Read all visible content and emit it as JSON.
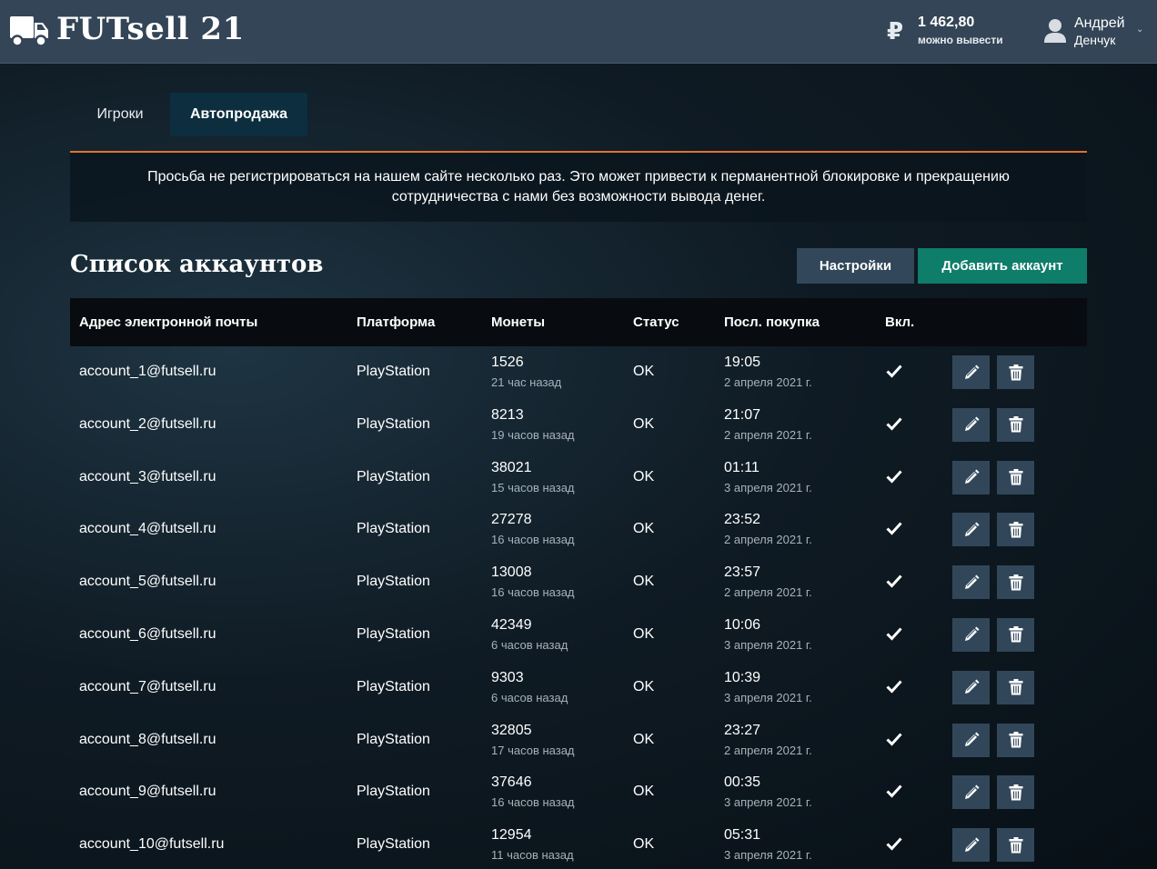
{
  "header": {
    "brand": "FUTsell 21",
    "logo_icon": "delivery-truck-icon",
    "balance": {
      "icon": "ruble-icon",
      "symbol": "₽",
      "amount": "1 462,80",
      "caption": "можно вывести"
    },
    "user": {
      "icon": "user-icon",
      "first_name": "Андрей",
      "last_name": "Денчук",
      "caret": "⌄"
    }
  },
  "tabs": [
    {
      "label": "Игроки",
      "active": false
    },
    {
      "label": "Автопродажа",
      "active": true
    }
  ],
  "notice": "Просьба не регистрироваться на нашем сайте несколько раз. Это может привести к перманентной блокировке и прекращению сотрудничества с нами без возможности вывода денег.",
  "accounts_section": {
    "title": "Список аккаунтов",
    "settings_button": "Настройки",
    "add_button": "Добавить аккаунт"
  },
  "table": {
    "columns": [
      "Адрес электронной почты",
      "Платформа",
      "Монеты",
      "Статус",
      "Посл. покупка",
      "Вкл."
    ],
    "rows": [
      {
        "email": "account_1@futsell.ru",
        "platform": "PlayStation",
        "coins": "1526",
        "coins_ago": "21 час назад",
        "status": "OK",
        "time": "19:05",
        "date": "2 апреля 2021 г.",
        "enabled": true
      },
      {
        "email": "account_2@futsell.ru",
        "platform": "PlayStation",
        "coins": "8213",
        "coins_ago": "19 часов назад",
        "status": "OK",
        "time": "21:07",
        "date": "2 апреля 2021 г.",
        "enabled": true
      },
      {
        "email": "account_3@futsell.ru",
        "platform": "PlayStation",
        "coins": "38021",
        "coins_ago": "15 часов назад",
        "status": "OK",
        "time": "01:11",
        "date": "3 апреля 2021 г.",
        "enabled": true
      },
      {
        "email": "account_4@futsell.ru",
        "platform": "PlayStation",
        "coins": "27278",
        "coins_ago": "16 часов назад",
        "status": "OK",
        "time": "23:52",
        "date": "2 апреля 2021 г.",
        "enabled": true
      },
      {
        "email": "account_5@futsell.ru",
        "platform": "PlayStation",
        "coins": "13008",
        "coins_ago": "16 часов назад",
        "status": "OK",
        "time": "23:57",
        "date": "2 апреля 2021 г.",
        "enabled": true
      },
      {
        "email": "account_6@futsell.ru",
        "platform": "PlayStation",
        "coins": "42349",
        "coins_ago": "6 часов назад",
        "status": "OK",
        "time": "10:06",
        "date": "3 апреля 2021 г.",
        "enabled": true
      },
      {
        "email": "account_7@futsell.ru",
        "platform": "PlayStation",
        "coins": "9303",
        "coins_ago": "6 часов назад",
        "status": "OK",
        "time": "10:39",
        "date": "3 апреля 2021 г.",
        "enabled": true
      },
      {
        "email": "account_8@futsell.ru",
        "platform": "PlayStation",
        "coins": "32805",
        "coins_ago": "17 часов назад",
        "status": "OK",
        "time": "23:27",
        "date": "2 апреля 2021 г.",
        "enabled": true
      },
      {
        "email": "account_9@futsell.ru",
        "platform": "PlayStation",
        "coins": "37646",
        "coins_ago": "16 часов назад",
        "status": "OK",
        "time": "00:35",
        "date": "3 апреля 2021 г.",
        "enabled": true
      },
      {
        "email": "account_10@futsell.ru",
        "platform": "PlayStation",
        "coins": "12954",
        "coins_ago": "11 часов назад",
        "status": "OK",
        "time": "05:31",
        "date": "3 апреля 2021 г.",
        "enabled": true
      }
    ],
    "row_icons": {
      "enabled": "checkmark-icon",
      "edit": "pencil-icon",
      "delete": "trash-icon"
    }
  },
  "colors": {
    "header_bg": "#334556",
    "accent_orange": "#e0722c",
    "add_button": "#0e7d6a",
    "secondary_button": "#324759",
    "active_tab": "#0c2e3e"
  }
}
